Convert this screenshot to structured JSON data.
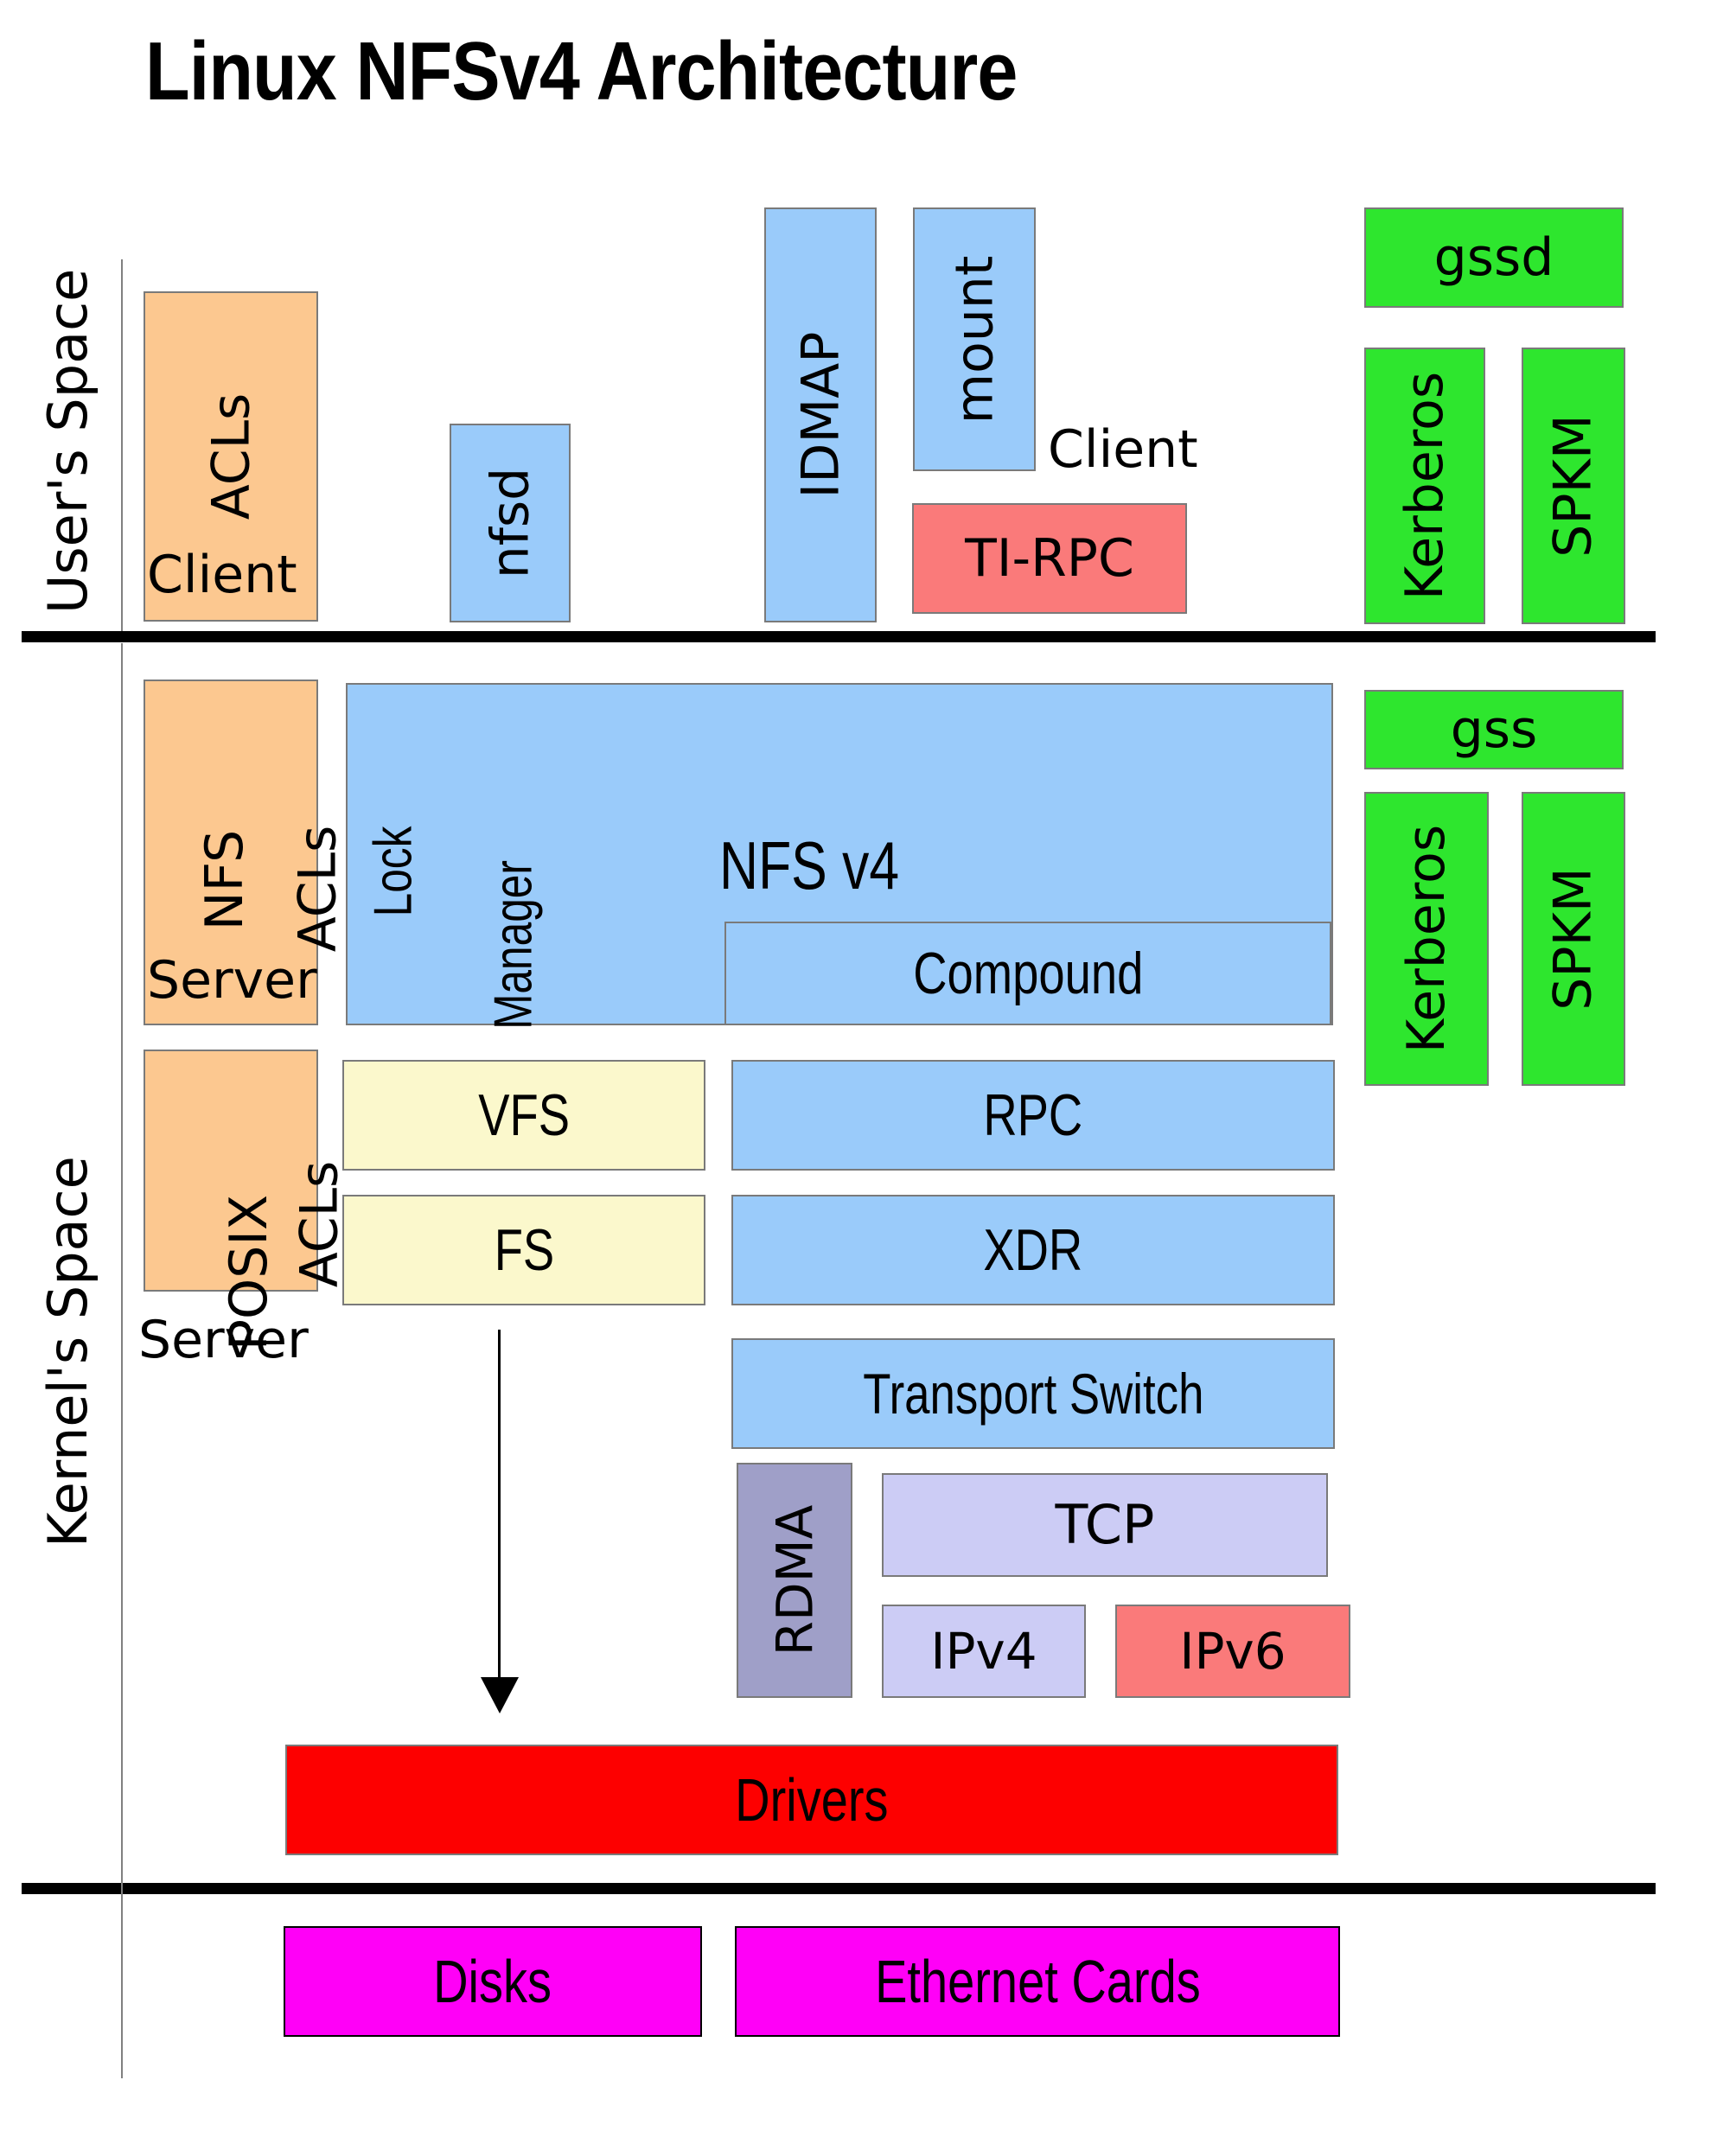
{
  "title": "Linux NFSv4 Architecture",
  "regions": {
    "user_space_label": "User's Space",
    "kernel_space_label": "Kernel's Space"
  },
  "colors": {
    "orange": "#fcc890",
    "blue": "#9acbfa",
    "red_salmon": "#fa7a7a",
    "green": "#2ee62e",
    "yellow": "#fbf8cc",
    "lavender": "#ccccf5",
    "slate": "#9f9fc8",
    "pure_red": "#fd0000",
    "magenta": "#ff00f7",
    "border": "#7a7a7a",
    "rule": "#000000"
  },
  "user_space": {
    "acls_client": {
      "label": "ACLs",
      "sublabel": "Client"
    },
    "nfsd": {
      "label": "nfsd"
    },
    "idmap": {
      "label": "IDMAP"
    },
    "mount": {
      "label": "mount"
    },
    "client_text": "Client",
    "tirpc": {
      "label": "TI-RPC"
    },
    "gssd": {
      "label": "gssd"
    },
    "kerberos": {
      "label": "Kerberos"
    },
    "spkm": {
      "label": "SPKM"
    }
  },
  "kernel_space": {
    "nfs_acls": {
      "label_a": "NFS",
      "label_b": "ACLs",
      "sublabel": "Server"
    },
    "posix_acls": {
      "label_a": "POSIX",
      "label_b": "ACLs"
    },
    "server_text": "Server",
    "lock_manager": {
      "label_a": "Lock",
      "label_b": "Manager"
    },
    "nfsv4": {
      "label": "NFS v4"
    },
    "compound": {
      "label": "Compound"
    },
    "vfs": {
      "label": "VFS"
    },
    "fs": {
      "label": "FS"
    },
    "rpc": {
      "label": "RPC"
    },
    "xdr": {
      "label": "XDR"
    },
    "transport_switch": {
      "label": "Transport Switch"
    },
    "rdma": {
      "label": "RDMA"
    },
    "tcp": {
      "label": "TCP"
    },
    "ipv4": {
      "label": "IPv4"
    },
    "ipv6": {
      "label": "IPv6"
    },
    "drivers": {
      "label": "Drivers"
    },
    "gss": {
      "label": "gss"
    },
    "kerberos": {
      "label": "Kerberos"
    },
    "spkm": {
      "label": "SPKM"
    }
  },
  "hardware": {
    "disks": {
      "label": "Disks"
    },
    "ethernet_cards": {
      "label": "Ethernet Cards"
    }
  }
}
